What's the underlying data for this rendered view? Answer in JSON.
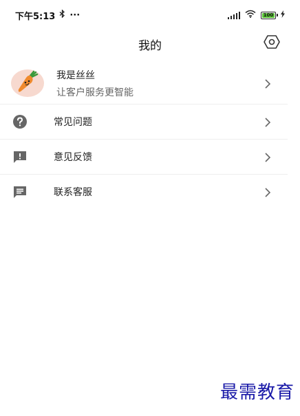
{
  "statusbar": {
    "time": "下午5:13",
    "bluetooth_icon": "bluetooth-icon",
    "more": "···",
    "battery": "100"
  },
  "header": {
    "title": "我的",
    "settings_icon": "settings-hexagon-icon"
  },
  "profile": {
    "name": "我是丝丝",
    "subtitle": "让客户服务更智能",
    "avatar_icon": "carrot-icon"
  },
  "menu": [
    {
      "label": "常见问题",
      "icon": "help-circle-icon"
    },
    {
      "label": "意见反馈",
      "icon": "feedback-icon"
    },
    {
      "label": "联系客服",
      "icon": "message-icon"
    }
  ],
  "watermark": "最需教育",
  "colors": {
    "icon_gray": "#666666",
    "divider": "#eeeeee",
    "battery_green": "#5ac436",
    "avatar_bg": "#f7d9cf",
    "carrot": "#f08a2d",
    "watermark": "#1a1aa8"
  }
}
